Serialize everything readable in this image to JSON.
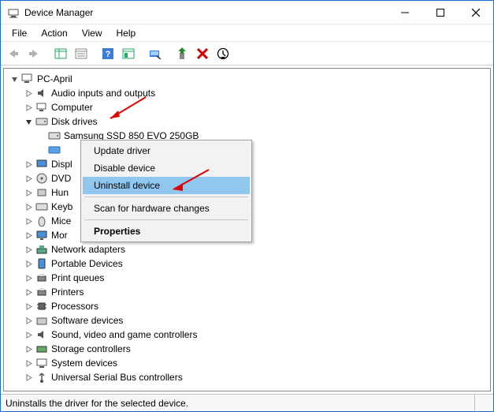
{
  "window": {
    "title": "Device Manager"
  },
  "menubar": {
    "file": "File",
    "action": "Action",
    "view": "View",
    "help": "Help"
  },
  "tree": {
    "root": "PC-April",
    "nodes": {
      "audio": "Audio inputs and outputs",
      "computer": "Computer",
      "disk": "Disk drives",
      "disk_child": "Samsung SSD 850 EVO 250GB",
      "display": "Displ",
      "dvd": "DVD",
      "hid": "Hun",
      "keyboards": "Keyb",
      "mice": "Mice",
      "monitors": "Mor",
      "network": "Network adapters",
      "portable": "Portable Devices",
      "printq": "Print queues",
      "printers": "Printers",
      "processors": "Processors",
      "software": "Software devices",
      "sound": "Sound, video and game controllers",
      "storage": "Storage controllers",
      "system": "System devices",
      "usb": "Universal Serial Bus controllers"
    }
  },
  "context_menu": {
    "update": "Update driver",
    "disable": "Disable device",
    "uninstall": "Uninstall device",
    "scan": "Scan for hardware changes",
    "properties": "Properties"
  },
  "statusbar": {
    "text": "Uninstalls the driver for the selected device."
  }
}
